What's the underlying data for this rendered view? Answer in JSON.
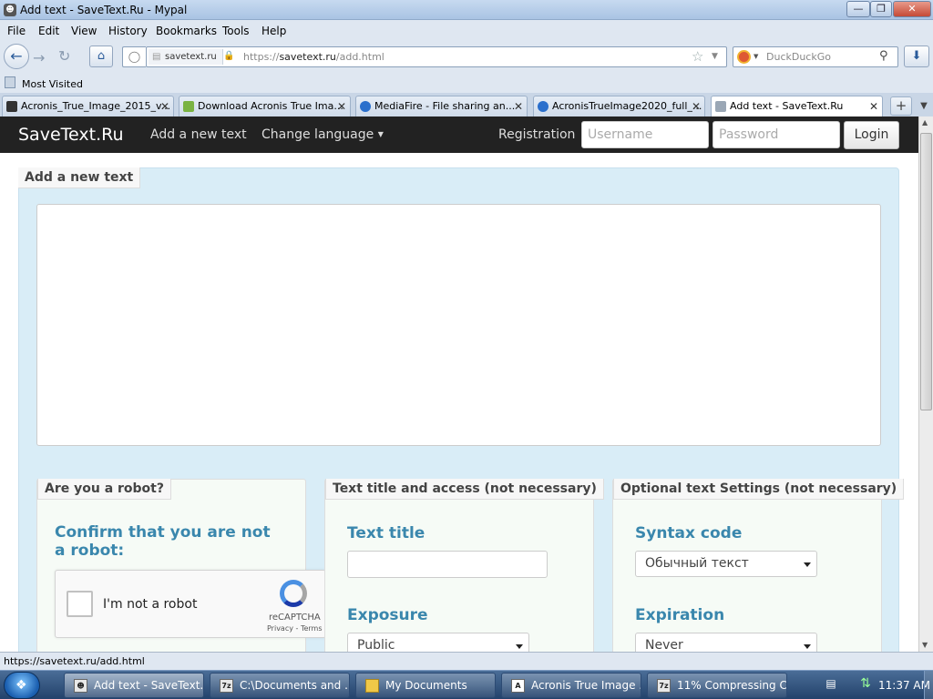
{
  "window": {
    "title": "Add text - SaveText.Ru - Mypal",
    "controls": {
      "minimize": "—",
      "maximize": "❐",
      "close": "✕"
    }
  },
  "menu": [
    "File",
    "Edit",
    "View",
    "History",
    "Bookmarks",
    "Tools",
    "Help"
  ],
  "nav": {
    "site_identity": "savetext.ru",
    "url_prefix": "https://",
    "url_host": "savetext.ru",
    "url_path": "/add.html",
    "search_placeholder": "DuckDuckGo"
  },
  "bookmarks": {
    "most_visited": "Most Visited"
  },
  "tabs": [
    {
      "label": "Acronis_True_Image_2015_v...",
      "icon_color": "#333333"
    },
    {
      "label": "Download Acronis True Ima...",
      "icon_color": "#7ab342"
    },
    {
      "label": "MediaFire - File sharing an...",
      "icon_color": "#2a6fcc"
    },
    {
      "label": "AcronisTrueImage2020_full_...",
      "icon_color": "#2a6fcc"
    },
    {
      "label": "Add text - SaveText.Ru",
      "icon_color": "#9aa7b5",
      "active": true
    }
  ],
  "site": {
    "brand": "SaveText.Ru",
    "add_new_text": "Add a new text",
    "change_language": "Change language",
    "registration": "Registration",
    "username_placeholder": "Username",
    "password_placeholder": "Password",
    "login": "Login"
  },
  "form": {
    "section_tag": "Add a new text",
    "robot": {
      "tag": "Are you a robot?",
      "heading": "Confirm that you are not a robot:",
      "captcha_label": "I'm not a robot",
      "captcha_brand": "reCAPTCHA",
      "captcha_links": "Privacy - Terms"
    },
    "title_access": {
      "tag": "Text title and access (not necessary)",
      "text_title": "Text title",
      "exposure": "Exposure",
      "exposure_value": "Public"
    },
    "settings": {
      "tag": "Optional text Settings (not necessary)",
      "syntax_code": "Syntax code",
      "syntax_value": "Обычный текст",
      "expiration": "Expiration",
      "expiration_value": "Never"
    }
  },
  "status_bar": {
    "text": "https://savetext.ru/add.html"
  },
  "taskbar": {
    "tasks": [
      {
        "label": "Add text - SaveText....",
        "icon": "mypal-icon",
        "active": true
      },
      {
        "label": "C:\\Documents and ...",
        "icon": "7z"
      },
      {
        "label": "My Documents",
        "icon": "folder"
      },
      {
        "label": "Acronis True Image ...",
        "icon": "A"
      },
      {
        "label": "11% Compressing C...",
        "icon": "7z"
      }
    ],
    "clock": "11:37 AM"
  },
  "colors": {
    "accent": "#3a87ad",
    "navbar": "#222222",
    "well": "#d9edf7"
  }
}
